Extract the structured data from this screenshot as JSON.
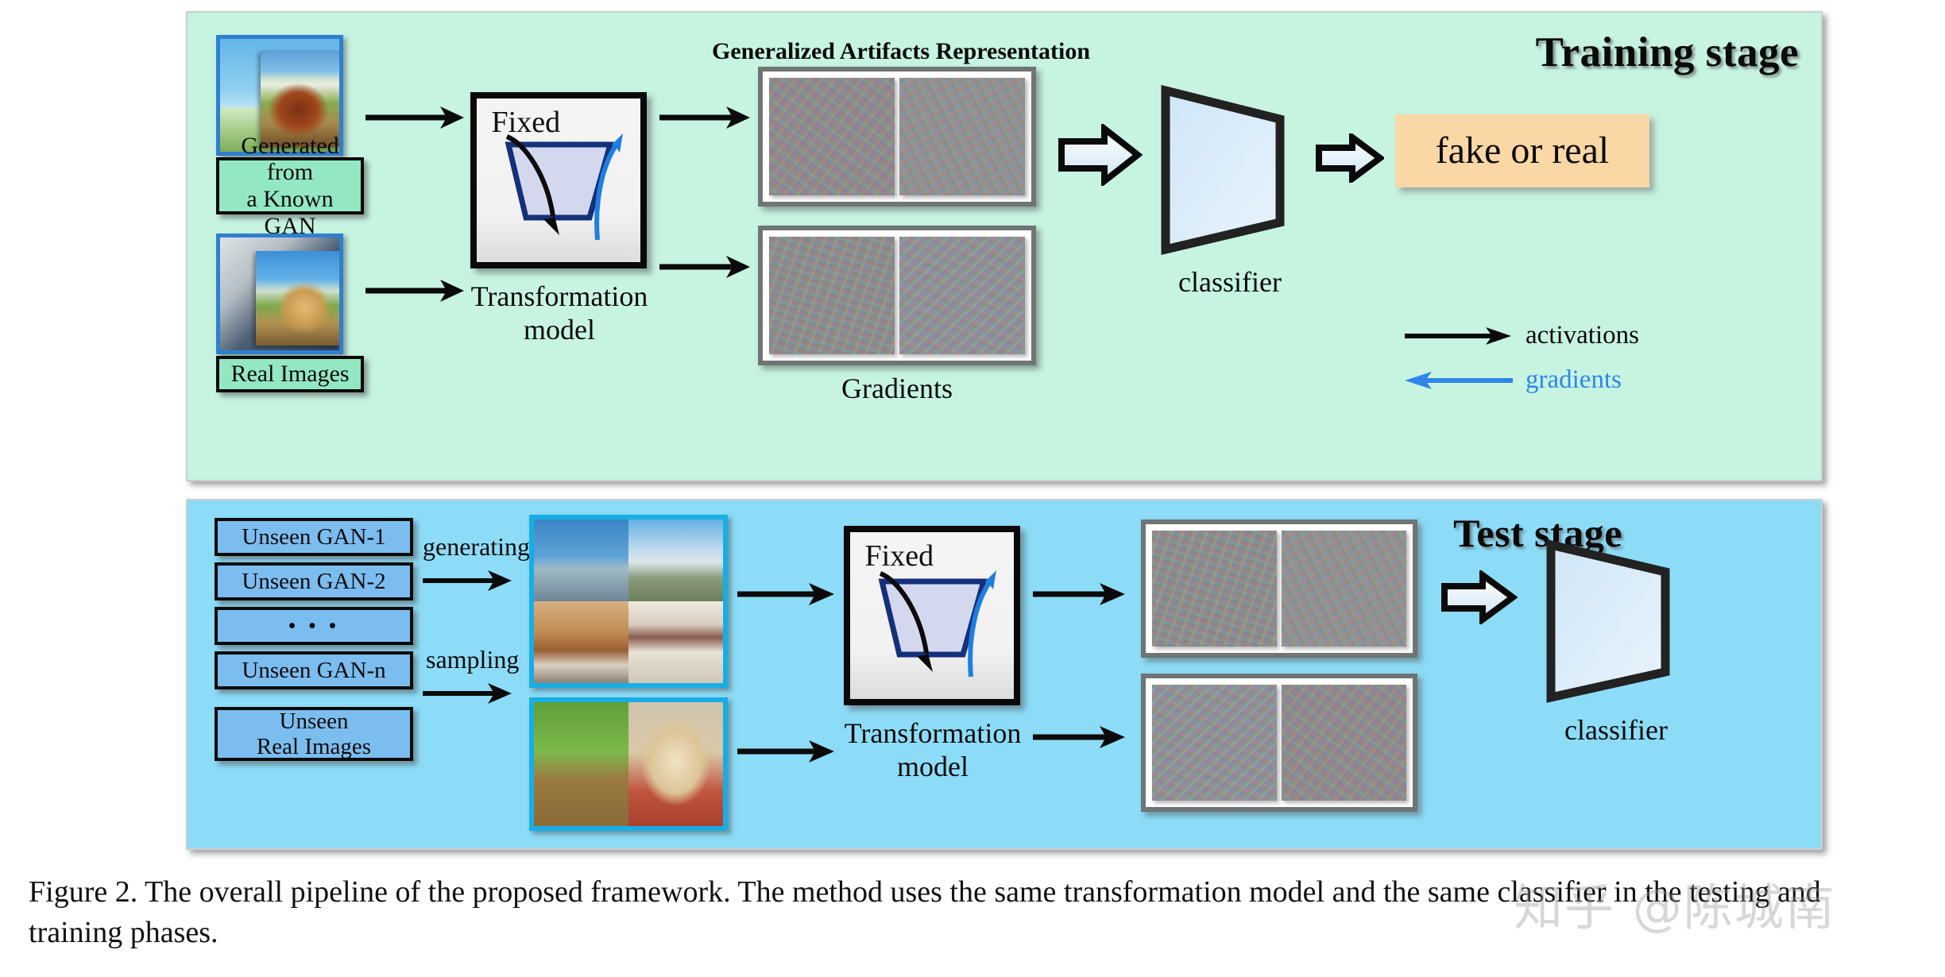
{
  "figure": {
    "caption": "Figure 2. The overall pipeline of the proposed framework. The method uses the same transformation model and the same classifier in the testing and training phases.",
    "watermark": "知乎 @陈城南"
  },
  "training": {
    "title": "Training stage",
    "inputs": [
      {
        "label": "Generated from\na Known GAN",
        "name": "generated-known-gan"
      },
      {
        "label": "Real Images",
        "name": "real-images"
      }
    ],
    "transformation": {
      "fixed_label": "Fixed",
      "caption": "Transformation\nmodel"
    },
    "artifacts_title": "Generalized Artifacts Representation",
    "gradients_caption": "Gradients",
    "classifier_label": "classifier",
    "output_label": "fake or real",
    "legend": [
      {
        "text": "activations",
        "color": "#0a0a0a",
        "direction": "right"
      },
      {
        "text": "gradients",
        "color": "#2f86e8",
        "direction": "left"
      }
    ]
  },
  "test": {
    "title": "Test stage",
    "sources": [
      {
        "label": "Unseen GAN-1"
      },
      {
        "label": "Unseen GAN-2"
      },
      {
        "label": "• • •"
      },
      {
        "label": "Unseen GAN-n"
      },
      {
        "label": "Unseen\nReal Images"
      }
    ],
    "edge_labels": [
      {
        "text": "generating"
      },
      {
        "text": "sampling"
      }
    ],
    "transformation": {
      "fixed_label": "Fixed",
      "caption": "Transformation\nmodel"
    },
    "classifier_label": "classifier"
  },
  "colors": {
    "training_bg": "#c6f4e1",
    "test_bg": "#8cdcf7",
    "mint_label": "#93e8c3",
    "blue_label": "#7cbdf0",
    "output_box": "#fad7a5",
    "gradient_arrow": "#2f86e8",
    "classifier_fill": "#d6eafa"
  }
}
